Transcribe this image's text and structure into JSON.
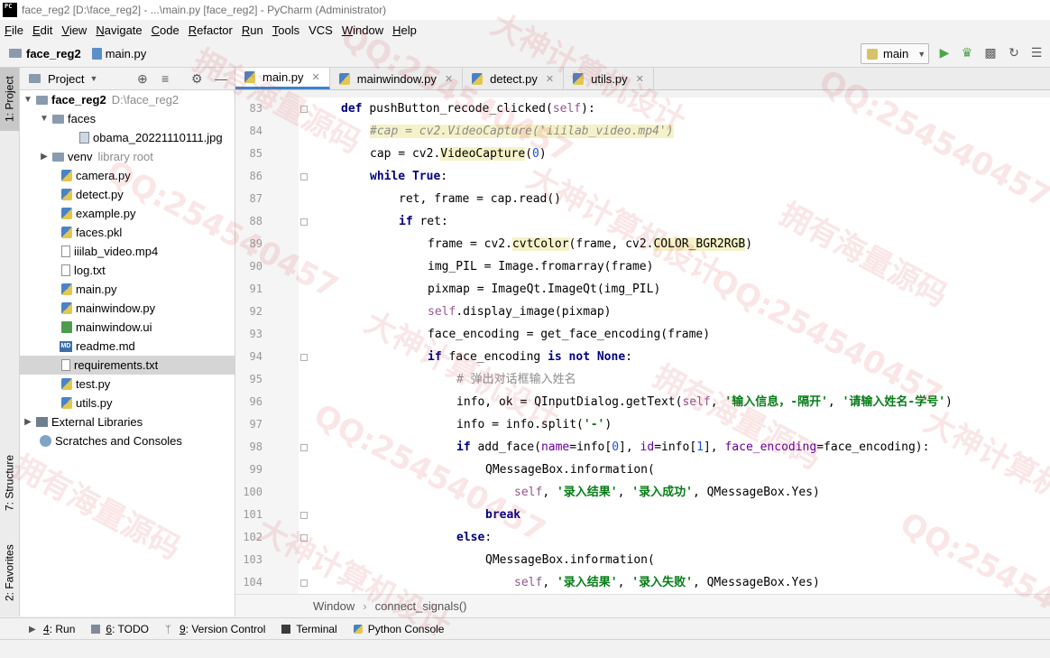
{
  "window": {
    "title": "face_reg2 [D:\\face_reg2] - ...\\main.py [face_reg2] - PyCharm (Administrator)",
    "logo": "PC"
  },
  "menu": [
    "File",
    "Edit",
    "View",
    "Navigate",
    "Code",
    "Refactor",
    "Run",
    "Tools",
    "VCS",
    "Window",
    "Help"
  ],
  "menu_mnemonics": [
    "F",
    "E",
    "V",
    "N",
    "C",
    "R",
    "R",
    "T",
    "",
    "W",
    "H"
  ],
  "navbar": {
    "project": "face_reg2",
    "file": "main.py"
  },
  "run_config": {
    "label": "main"
  },
  "left_strip": {
    "project_tab": "1: Project",
    "structure_tab": "7: Structure",
    "favorites_tab": "2: Favorites"
  },
  "project_panel": {
    "title": "Project",
    "root_name": "face_reg2",
    "root_path": "D:\\face_reg2",
    "items": [
      {
        "label": "faces",
        "icon": "folder-icon"
      },
      {
        "label": "obama_20221110111.jpg",
        "icon": "image-icon"
      },
      {
        "label": "venv",
        "extra": "library root",
        "icon": "folder-icon"
      },
      {
        "label": "camera.py",
        "icon": "python-file-icon"
      },
      {
        "label": "detect.py",
        "icon": "python-file-icon"
      },
      {
        "label": "example.py",
        "icon": "python-file-icon"
      },
      {
        "label": "faces.pkl",
        "icon": "python-file-icon"
      },
      {
        "label": "iiilab_video.mp4",
        "icon": "file-icon"
      },
      {
        "label": "log.txt",
        "icon": "text-file-icon"
      },
      {
        "label": "main.py",
        "icon": "python-file-icon"
      },
      {
        "label": "mainwindow.py",
        "icon": "python-file-icon"
      },
      {
        "label": "mainwindow.ui",
        "icon": "ui-file-icon"
      },
      {
        "label": "readme.md",
        "icon": "markdown-file-icon"
      },
      {
        "label": "requirements.txt",
        "icon": "text-file-icon"
      },
      {
        "label": "test.py",
        "icon": "python-file-icon"
      },
      {
        "label": "utils.py",
        "icon": "python-file-icon"
      }
    ],
    "external_libraries": "External Libraries",
    "scratches": "Scratches and Consoles"
  },
  "editor_tabs": [
    "main.py",
    "mainwindow.py",
    "detect.py",
    "utils.py"
  ],
  "line_numbers": [
    "83",
    "84",
    "85",
    "86",
    "87",
    "88",
    "89",
    "90",
    "91",
    "92",
    "93",
    "94",
    "95",
    "96",
    "97",
    "98",
    "99",
    "100",
    "101",
    "102",
    "103",
    "104"
  ],
  "code": {
    "l83_def": "def ",
    "l83_name": "pushButton_recode_clicked(",
    "l83_self": "self",
    "l83_end": "):",
    "l84": "#cap = cv2.VideoCapture('iiilab_video.mp4')",
    "l85_a": "cap = cv2.",
    "l85_b": "VideoCapture",
    "l85_c": "(",
    "l85_num": "0",
    "l85_d": ")",
    "l86_kw": "while ",
    "l86_kw2": "True",
    "l86_end": ":",
    "l87": "ret, frame = cap.read()",
    "l88_kw": "if ",
    "l88_rest": "ret:",
    "l89_a": "frame = cv2.",
    "l89_b": "cvtColor",
    "l89_c": "(frame, cv2.",
    "l89_d": "COLOR_BGR2RGB",
    "l89_e": ")",
    "l90": "img_PIL = Image.fromarray(frame)",
    "l91": "pixmap = ImageQt.ImageQt(img_PIL)",
    "l92_self": "self",
    "l92_rest": ".display_image(pixmap)",
    "l93": "face_encoding = get_face_encoding(frame)",
    "l94_kw": "if ",
    "l94_a": "face_encoding ",
    "l94_kw2": "is not None",
    "l94_end": ":",
    "l95": "# 弹出对话框输入姓名",
    "l96_a": "info, ok = QInputDialog.getText(",
    "l96_self": "self",
    "l96_b": ", ",
    "l96_s1": "'输入信息，-隔开'",
    "l96_c": ", ",
    "l96_s2": "'请输入姓名-学号'",
    "l96_d": ")",
    "l97_a": "info = info.split(",
    "l97_s": "'-'",
    "l97_b": ")",
    "l98_kw": "if ",
    "l98_a": "add_face(",
    "l98_p1": "name",
    "l98_b": "=info[",
    "l98_n1": "0",
    "l98_c": "], ",
    "l98_p2": "id",
    "l98_d": "=info[",
    "l98_n2": "1",
    "l98_e": "], ",
    "l98_p3": "face_encoding",
    "l98_f": "=face_encoding):",
    "l99": "QMessageBox.information(",
    "l100_self": "self",
    "l100_a": ", ",
    "l100_s1": "'录入结果'",
    "l100_b": ", ",
    "l100_s2": "'录入成功'",
    "l100_c": ", QMessageBox.Yes)",
    "l101": "break",
    "l102_kw": "else",
    "l102_end": ":",
    "l103": "QMessageBox.information(",
    "l104_self": "self",
    "l104_a": ", ",
    "l104_s1": "'录入结果'",
    "l104_b": ", ",
    "l104_s2": "'录入失败'",
    "l104_c": ", QMessageBox.Yes)"
  },
  "breadcrumb": [
    "Window",
    "connect_signals()"
  ],
  "bottom_tabs": [
    {
      "num": "4",
      "label": ": Run"
    },
    {
      "num": "6",
      "label": ": TODO"
    },
    {
      "num": "9",
      "label": ": Version Control"
    },
    {
      "num": "",
      "label": "Terminal"
    },
    {
      "num": "",
      "label": "Python Console"
    }
  ],
  "watermarks": [
    "QQ:254540457",
    "拥有海量源码",
    "大神计算机设计"
  ]
}
